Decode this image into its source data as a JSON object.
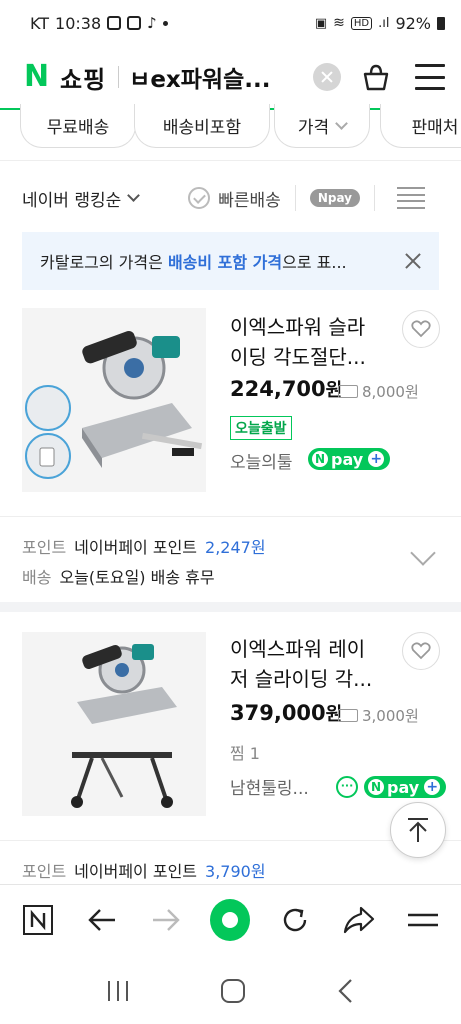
{
  "status": {
    "carrier": "KT",
    "time": "10:38",
    "battery": "92%"
  },
  "header": {
    "logo_letter": "N",
    "service": "쇼핑",
    "query": "ㅂex파워슬..."
  },
  "filters": {
    "chips": [
      "무료배송",
      "배송비포함",
      "가격",
      "판매처"
    ]
  },
  "sort": {
    "label": "네이버 랭킹순",
    "fast_delivery": "빠른배송",
    "npay": "Npay"
  },
  "notice": {
    "pre": "카탈로그의 가격은 ",
    "highlight": "배송비 포함 가격",
    "post": "으로 표..."
  },
  "products": [
    {
      "title_line1": "이엑스파워 슬라",
      "title_line2": "이딩 각도절단...",
      "price": "224,700",
      "price_unit": "원",
      "shipping": "8,000원",
      "badge": "오늘출발",
      "seller": "오늘의툴",
      "npay_label": "pay",
      "point_key": "포인트",
      "point_label": "네이버페이 포인트",
      "point_value": "2,247원",
      "delivery_key": "배송",
      "delivery_value": "오늘(토요일) 배송 휴무"
    },
    {
      "title_line1": "이엑스파워 레이",
      "title_line2": "저 슬라이딩 각...",
      "price": "379,000",
      "price_unit": "원",
      "shipping": "3,000원",
      "dibs": "찜 1",
      "seller": "남현툴링...",
      "npay_label": "pay",
      "point_key": "포인트",
      "point_label": "네이버페이 포인트",
      "point_value": "3,790원"
    }
  ],
  "icons": {
    "accent": "#03c75a",
    "link": "#2f6fd8"
  }
}
